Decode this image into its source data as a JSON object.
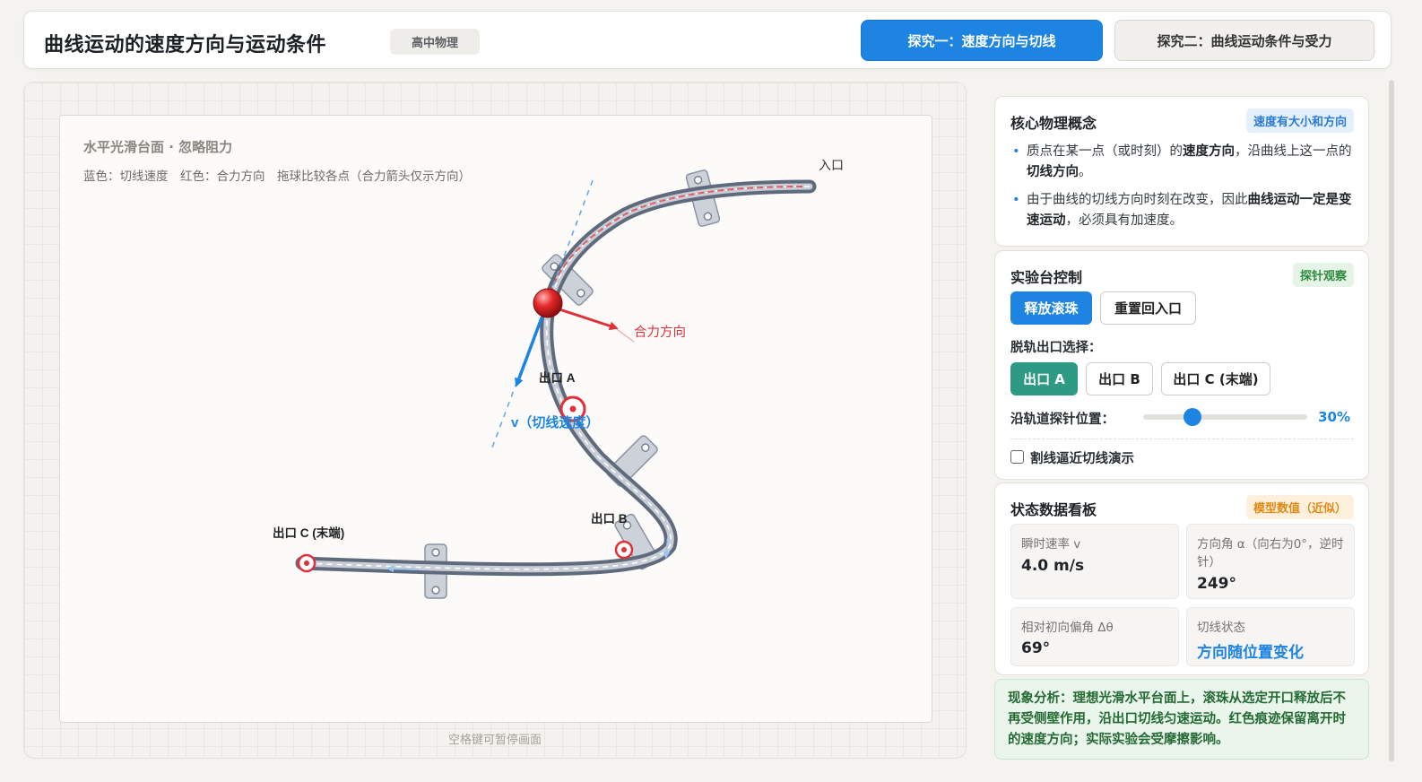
{
  "header": {
    "title": "曲线运动的速度方向与运动条件",
    "level_badge": "高中物理",
    "tabs": [
      {
        "label": "探究一：速度方向与切线",
        "active": true
      },
      {
        "label": "探究二：曲线运动条件与受力",
        "active": false
      }
    ]
  },
  "stage": {
    "title": "水平光滑台面 · 忽略阻力",
    "legend": "蓝色：切线速度　红色：合力方向　拖球比较各点（合力箭头仅示方向）",
    "labels": {
      "entry": "入口",
      "exit_a": "出口 A",
      "exit_b": "出口 B",
      "exit_c": "出口 C (末端)",
      "force": "合力方向",
      "velocity": "v（切线速度）"
    },
    "hint": "空格键可暂停画面",
    "colors": {
      "velocity": "#1d84e2",
      "force": "#e0303a",
      "track": "#5f6b7d"
    }
  },
  "concepts": {
    "title": "核心物理概念",
    "tag": "速度有大小和方向",
    "items": [
      [
        "质点在某一点（或时刻）的",
        "速度方向",
        "，沿曲线上这一点的",
        "切线方向",
        "。"
      ],
      [
        "由于曲线的切线方向时刻在改变，因此",
        "曲线运动一定是变速运动",
        "，必须具有加速度。"
      ]
    ]
  },
  "controls": {
    "title": "实验台控制",
    "tag": "探针观察",
    "release_label": "释放滚珠",
    "reset_label": "重置回入口",
    "exit_label": "脱轨出口选择：",
    "exits": [
      "出口 A",
      "出口 B",
      "出口 C (末端)"
    ],
    "selected_exit": "出口 A",
    "probe_label": "沿轨道探针位置：",
    "probe_value": "30%",
    "probe_fraction": 0.3,
    "secant_label": "割线逼近切线演示",
    "secant_checked": false
  },
  "dashboard": {
    "title": "状态数据看板",
    "tag": "模型数值（近似）",
    "speed_label": "瞬时速率 v",
    "speed_value": "4.0 m/s",
    "angle_label": "方向角 α（向右为0°，逆时针）",
    "angle_value": "249°",
    "deviation_label": "相对初向偏角 Δθ",
    "deviation_value": "69°",
    "tangent_label": "切线状态",
    "tangent_value": "方向随位置变化"
  },
  "analysis": "现象分析：理想光滑水平台面上，滚珠从选定开口释放后不再受侧壁作用，沿出口切线匀速运动。红色痕迹保留离开时的速度方向；实际实验会受摩擦影响。"
}
